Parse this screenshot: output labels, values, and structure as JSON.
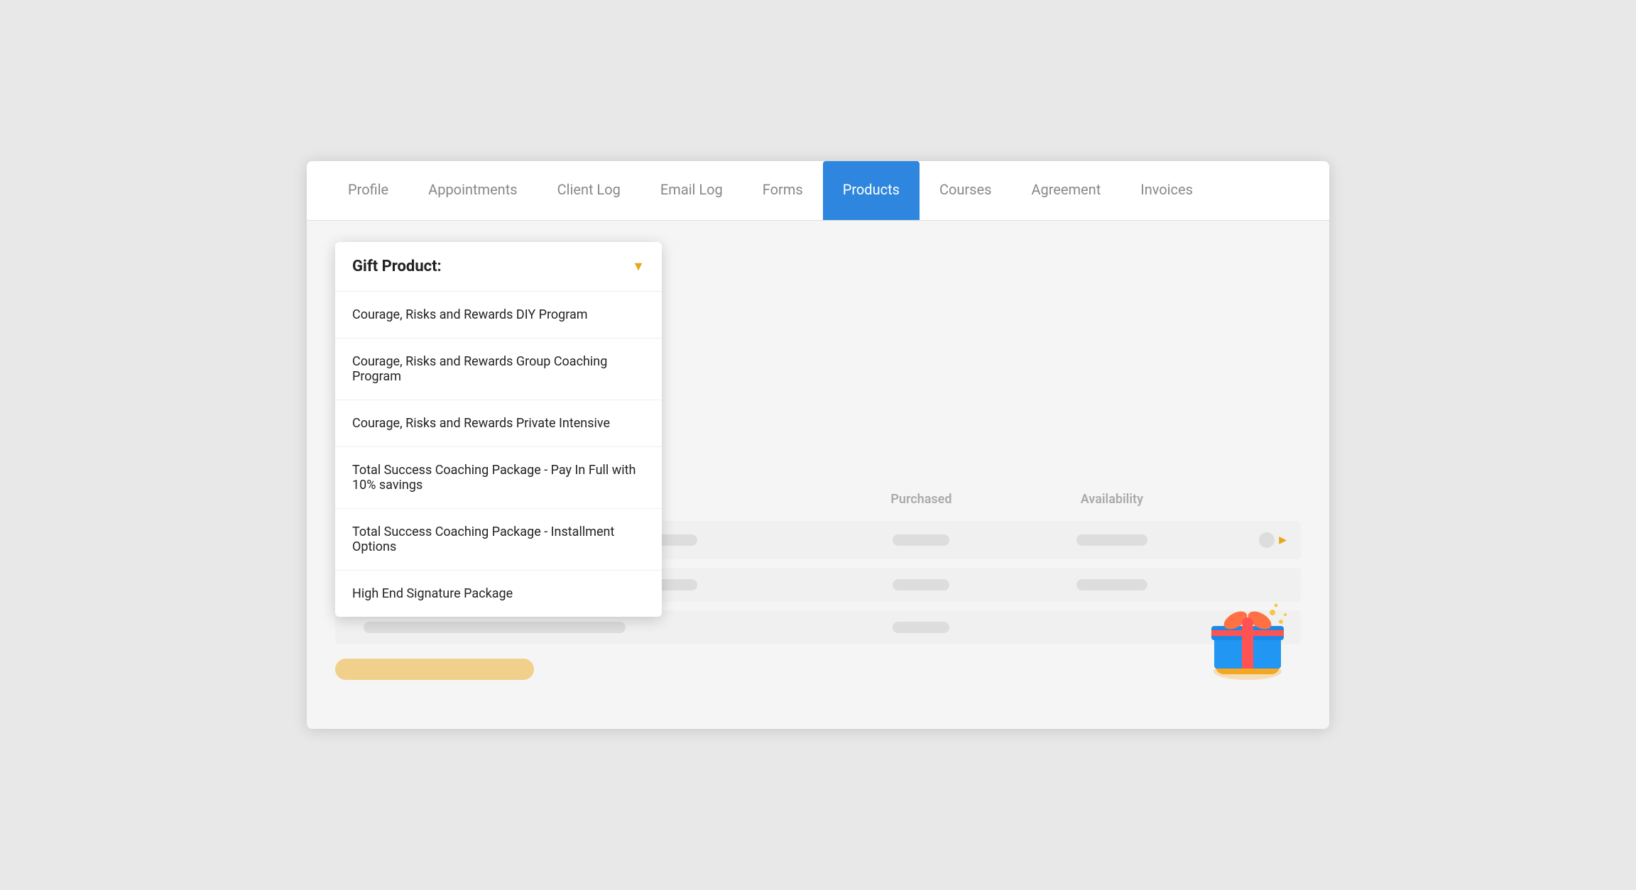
{
  "tabs": [
    {
      "id": "profile",
      "label": "Profile",
      "active": false
    },
    {
      "id": "appointments",
      "label": "Appointments",
      "active": false
    },
    {
      "id": "client-log",
      "label": "Client Log",
      "active": false
    },
    {
      "id": "email-log",
      "label": "Email Log",
      "active": false
    },
    {
      "id": "forms",
      "label": "Forms",
      "active": false
    },
    {
      "id": "products",
      "label": "Products",
      "active": true
    },
    {
      "id": "courses",
      "label": "Courses",
      "active": false
    },
    {
      "id": "agreement",
      "label": "Agreement",
      "active": false
    },
    {
      "id": "invoices",
      "label": "Invoices",
      "active": false
    }
  ],
  "dropdown": {
    "header_label": "Gift Product:",
    "items": [
      {
        "id": "item1",
        "label": "Courage, Risks and Rewards DIY Program"
      },
      {
        "id": "item2",
        "label": "Courage, Risks and Rewards Group Coaching Program"
      },
      {
        "id": "item3",
        "label": "Courage, Risks and Rewards Private Intensive"
      },
      {
        "id": "item4",
        "label": "Total Success Coaching Package - Pay In Full with 10% savings"
      },
      {
        "id": "item5",
        "label": "Total Success Coaching Package - Installment Options"
      },
      {
        "id": "item6",
        "label": "High End Signature Package"
      }
    ]
  },
  "table": {
    "columns": {
      "purchased": "Purchased",
      "availability": "Availability"
    }
  },
  "colors": {
    "active_tab_bg": "#2e86de",
    "dropdown_arrow": "#e6a817",
    "skeleton": "#dddddd"
  }
}
